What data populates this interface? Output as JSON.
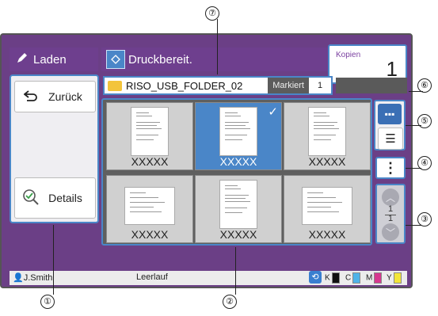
{
  "header": {
    "load_label": "Laden",
    "status_label": "Druckbereit."
  },
  "copies": {
    "label": "Kopien",
    "value": "1"
  },
  "left_panel": {
    "back_label": "Zurück",
    "details_label": "Details"
  },
  "folder": {
    "name": "RISO_USB_FOLDER_02",
    "marked_label": "Markiert",
    "marked_count": "1"
  },
  "thumbnails": [
    {
      "caption": "XXXXX",
      "selected": false,
      "orientation": "portrait"
    },
    {
      "caption": "XXXXX",
      "selected": true,
      "orientation": "portrait"
    },
    {
      "caption": "XXXXX",
      "selected": false,
      "orientation": "portrait"
    },
    {
      "caption": "XXXXX",
      "selected": false,
      "orientation": "landscape"
    },
    {
      "caption": "XXXXX",
      "selected": false,
      "orientation": "portrait"
    },
    {
      "caption": "XXXXX",
      "selected": false,
      "orientation": "landscape"
    }
  ],
  "pager": {
    "current": "1",
    "total": "1"
  },
  "status_bar": {
    "user": "J.Smith",
    "state": "Leerlauf",
    "inks": [
      {
        "label": "K",
        "color": "#111111"
      },
      {
        "label": "C",
        "color": "#4fb3e8"
      },
      {
        "label": "M",
        "color": "#d6388f"
      },
      {
        "label": "Y",
        "color": "#f2e53a"
      }
    ]
  },
  "callouts": [
    "①",
    "②",
    "③",
    "④",
    "⑤",
    "⑥",
    "⑦"
  ],
  "colors": {
    "accent": "#4a86c8",
    "brand": "#6e3f8e"
  }
}
